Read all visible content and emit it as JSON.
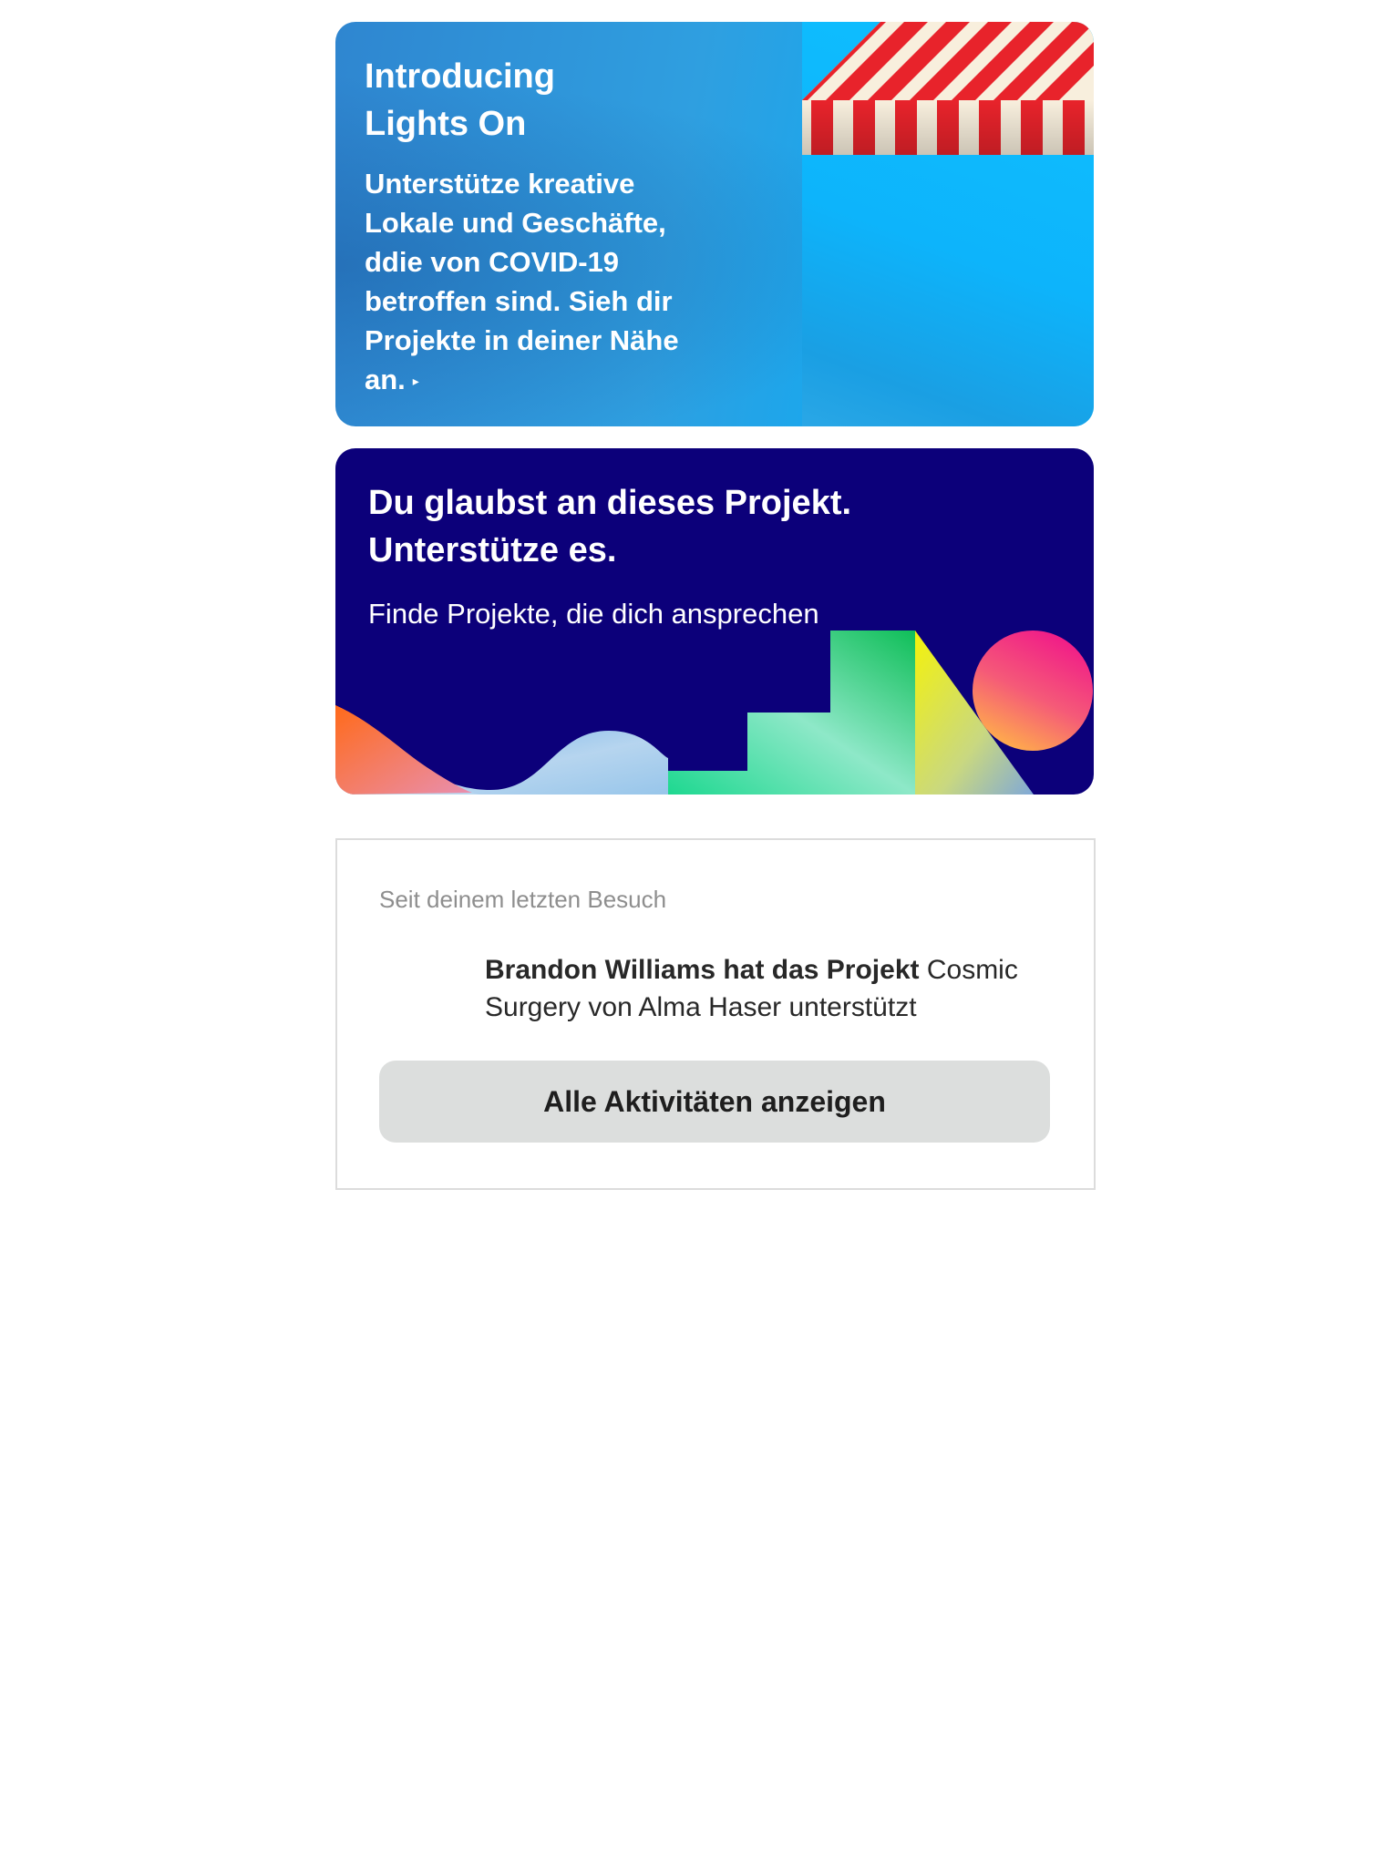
{
  "lights_on_card": {
    "title": "Introducing\nLights On",
    "body": "Unterstütze kreative Lokale und Geschäfte, ddie von COVID-19 betroffen sind. Sieh dir Projekte in deiner Nähe an.",
    "arrow": "▸",
    "colors": {
      "background": "#2f9fe0",
      "awning_red": "#e8232b",
      "awning_cream": "#f8efdd"
    }
  },
  "project_card": {
    "title": "Du glaubst an dieses Projekt.\nUnterstütze es.",
    "subtitle": "Finde Projekte, die dich ansprechen",
    "colors": {
      "background": "#0c007a"
    }
  },
  "activity_card": {
    "header": "Seit deinem letzten Besuch",
    "item": {
      "actor": "Brandon Williams hat das Projekt",
      "project": "Cosmic Surgery von Alma Haser unterstützt"
    },
    "button_label": "Alle Aktivitäten anzeigen"
  }
}
